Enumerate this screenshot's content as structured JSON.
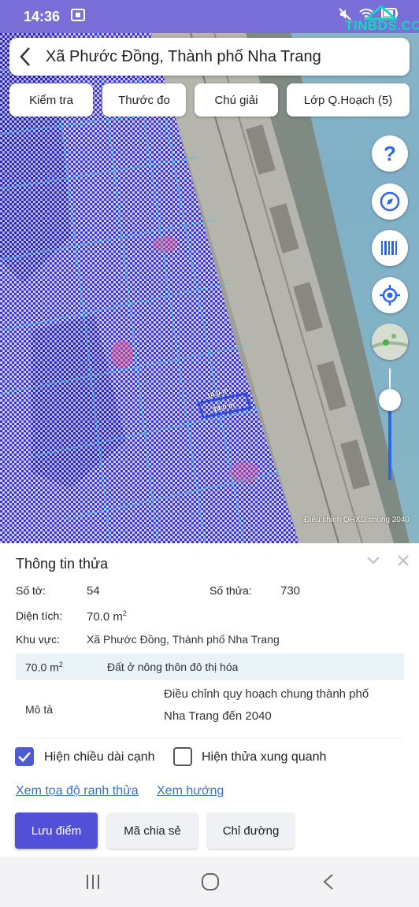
{
  "status_bar": {
    "time": "14:36",
    "screenshot_indicator": "screenshot-icon",
    "icons": [
      "mute-icon",
      "wifi-icon",
      "battery-icon"
    ]
  },
  "watermark": {
    "text": "TINBDS.COM",
    "color": "#13d6c0"
  },
  "search": {
    "title": "Xã Phước Đồng, Thành phố Nha Trang"
  },
  "toolbar": {
    "check_label": "Kiểm tra",
    "measure_label": "Thước đo",
    "legend_label": "Chú giải",
    "layer_label": "Lớp Q.Hoạch (5)"
  },
  "side_controls": {
    "help": "?",
    "icons": [
      "help-icon",
      "compass-icon",
      "barcode-icon",
      "locate-icon",
      "minimap-icon"
    ],
    "opacity_level": 0.7
  },
  "map": {
    "dim_top": "14.0 m",
    "dim_bottom": "14.0 m",
    "attribution": "Điều chỉnh QHXD chung 2040",
    "overlay_color": "#3b34d6"
  },
  "panel": {
    "title": "Thông tin thửa",
    "sheet_label": "Số tờ:",
    "sheet_value": "54",
    "parcel_label": "Số thửa:",
    "parcel_value": "730",
    "area_label": "Diện tích:",
    "area_value": "70.0 m",
    "area_unit_exp": "2",
    "region_label": "Khu vực:",
    "region_value": "Xã Phước Đồng, Thành phố Nha Trang",
    "table": {
      "row1_area": "70.0 m",
      "row1_area_exp": "2",
      "row1_type": "Đất ở nông thôn đô thị hóa",
      "row2_label": "Mô tả",
      "row2_line1": "Điều chỉnh quy hoạch chung thành phố",
      "row2_line2": "Nha Trang đến 2040"
    },
    "show_edge_length": "Hiện chiều dài cạnh",
    "show_edge_length_checked": true,
    "show_neighbors": "Hiện thửa xung quanh",
    "show_neighbors_checked": false,
    "link_coords": "Xem tọa độ ranh thửa",
    "link_direction": "Xem hướng",
    "btn_save": "Lưu điểm",
    "btn_share": "Mã chia sẻ",
    "btn_route": "Chỉ đường"
  },
  "nav": {
    "icons": [
      "recents-icon",
      "home-icon",
      "back-icon"
    ]
  }
}
